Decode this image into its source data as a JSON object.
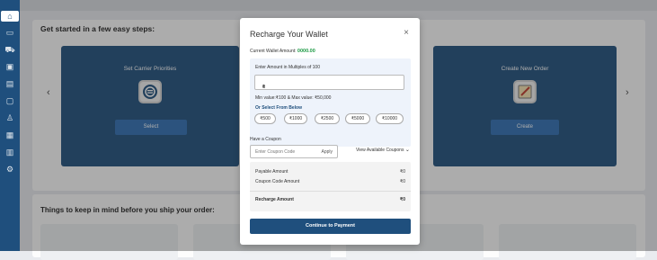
{
  "sidebar": {
    "icons": [
      "home-icon",
      "wallet-icon",
      "truck-icon",
      "inbox-icon",
      "box-icon",
      "package-icon",
      "user-icon",
      "calendar-icon",
      "document-icon",
      "settings-icon"
    ]
  },
  "section1": {
    "heading": "Get started in a few easy steps:",
    "card_left": {
      "title": "Set Carrier Priorities",
      "button": "Select"
    },
    "card_right": {
      "title": "Create New Order",
      "button": "Create"
    },
    "prev": "‹",
    "next": "›"
  },
  "section2": {
    "heading": "Things to keep in mind before you ship your order:"
  },
  "modal": {
    "title": "Recharge Your Wallet",
    "close": "×",
    "balance_label": "Current Wallet Amount:",
    "balance_value": "0000.00",
    "amount_label": "Enter Amount in Multiples of 100",
    "currency_symbol": "₹",
    "amount_value": "0",
    "minmax": "Min value:₹100 & Max value: ₹50,000",
    "select_below": "Or Select From Below",
    "chips": [
      "₹500",
      "₹1000",
      "₹2500",
      "₹5000",
      "₹10000"
    ],
    "coupon_question": "Have a Coupon",
    "coupon_placeholder": "Enter Coupon Code",
    "apply": "Apply",
    "view_coupons": "View Available Coupons",
    "payable_label": "Payable Amount",
    "payable_value": "₹0",
    "coupon_amount_label": "Coupon Code Amount",
    "coupon_amount_value": "₹0",
    "recharge_label": "Recharge Amount",
    "recharge_value": "₹0",
    "pay_button": "Continue to Payment"
  },
  "colors": {
    "primary": "#1f4f7d",
    "accent": "#2f6fb3",
    "success": "#1d9a45"
  }
}
